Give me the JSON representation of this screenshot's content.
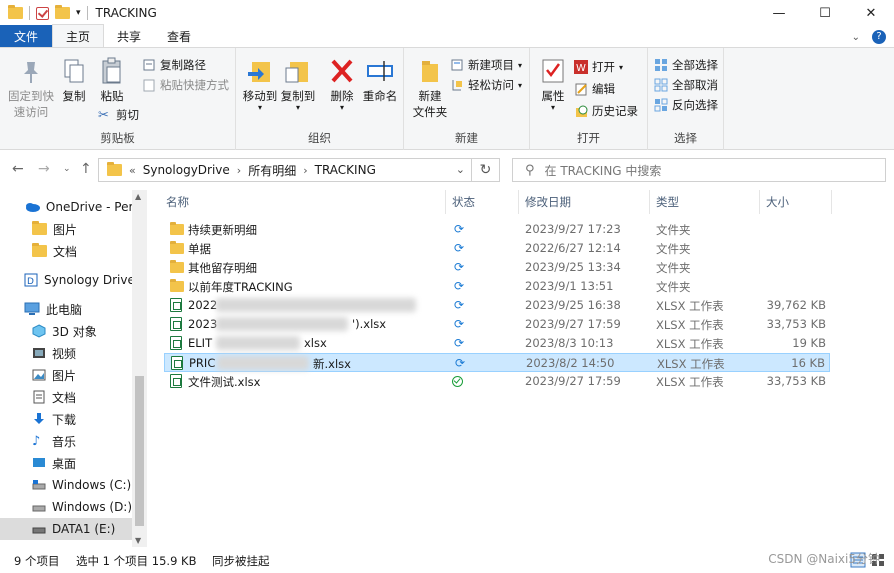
{
  "window": {
    "title": "TRACKING",
    "controls": {
      "minimize": "—",
      "maximize": "☐",
      "close": "✕"
    }
  },
  "ribbon_tabs": [
    "文件",
    "主页",
    "共享",
    "查看"
  ],
  "ribbon": {
    "clipboard": {
      "label": "剪贴板",
      "pin": "固定到快\n速访问",
      "copy": "复制",
      "paste": "粘贴",
      "copy_path": "复制路径",
      "paste_shortcut": "粘贴快捷方式",
      "cut": "剪切"
    },
    "organize": {
      "label": "组织",
      "move_to": "移动到",
      "copy_to": "复制到",
      "delete": "删除",
      "rename": "重命名"
    },
    "new": {
      "label": "新建",
      "new_folder": "新建\n文件夹",
      "new_item": "新建项目",
      "easy_access": "轻松访问"
    },
    "open": {
      "label": "打开",
      "properties": "属性",
      "open": "打开",
      "edit": "编辑",
      "history": "历史记录"
    },
    "select": {
      "label": "选择",
      "select_all": "全部选择",
      "select_none": "全部取消",
      "invert": "反向选择"
    }
  },
  "address": {
    "prefix": "«",
    "crumbs": [
      "SynologyDrive",
      "所有明细",
      "TRACKING"
    ],
    "search_placeholder": "在 TRACKING 中搜索"
  },
  "nav_items": [
    {
      "label": "OneDrive - Perso",
      "icon": "cloud-icon"
    },
    {
      "label": "图片",
      "icon": "folder-icon"
    },
    {
      "label": "文档",
      "icon": "folder-icon"
    },
    {
      "label": "Synology Drive -",
      "icon": "synology-icon"
    },
    {
      "label": "此电脑",
      "icon": "computer-icon"
    },
    {
      "label": "3D 对象",
      "icon": "cube-icon"
    },
    {
      "label": "视频",
      "icon": "video-icon"
    },
    {
      "label": "图片",
      "icon": "picture-icon"
    },
    {
      "label": "文档",
      "icon": "document-icon"
    },
    {
      "label": "下载",
      "icon": "download-icon"
    },
    {
      "label": "音乐",
      "icon": "music-icon"
    },
    {
      "label": "桌面",
      "icon": "desktop-icon"
    },
    {
      "label": "Windows (C:)",
      "icon": "drive-icon"
    },
    {
      "label": "Windows (D:)",
      "icon": "drive-icon"
    },
    {
      "label": "DATA1 (E:)",
      "icon": "drive-icon"
    }
  ],
  "columns": {
    "name": "名称",
    "status": "状态",
    "modified": "修改日期",
    "type": "类型",
    "size": "大小"
  },
  "files": [
    {
      "name": "持续更新明细",
      "kind": "folder",
      "status": "sync",
      "modified": "2023/9/27 17:23",
      "type": "文件夹",
      "size": ""
    },
    {
      "name": "单据",
      "kind": "folder",
      "status": "sync",
      "modified": "2022/6/27 12:14",
      "type": "文件夹",
      "size": ""
    },
    {
      "name": "其他留存明细",
      "kind": "folder",
      "status": "sync",
      "modified": "2023/9/25 13:34",
      "type": "文件夹",
      "size": ""
    },
    {
      "name": "以前年度TRACKING",
      "kind": "folder",
      "status": "sync",
      "modified": "2023/9/1 13:51",
      "type": "文件夹",
      "size": ""
    },
    {
      "name": "2022",
      "kind": "xlsx",
      "status": "sync",
      "modified": "2023/9/25 16:38",
      "type": "XLSX 工作表",
      "size": "39,762 KB"
    },
    {
      "name": "2023",
      "name_tail": "').xlsx",
      "kind": "xlsx",
      "status": "sync",
      "modified": "2023/9/27 17:59",
      "type": "XLSX 工作表",
      "size": "33,753 KB"
    },
    {
      "name": "ELIT",
      "name_tail": "xlsx",
      "kind": "xlsx",
      "status": "sync",
      "modified": "2023/8/3 10:13",
      "type": "XLSX 工作表",
      "size": "19 KB"
    },
    {
      "name": "PRIC",
      "name_tail": "新.xlsx",
      "kind": "xlsx",
      "status": "sync",
      "modified": "2023/8/2 14:50",
      "type": "XLSX 工作表",
      "size": "16 KB",
      "selected": true
    },
    {
      "name": "文件测试.xlsx",
      "kind": "xlsx",
      "status": "ok",
      "modified": "2023/9/27 17:59",
      "type": "XLSX 工作表",
      "size": "33,753 KB"
    }
  ],
  "statusbar": {
    "count": "9 个项目",
    "selected": "选中 1 个项目  15.9 KB",
    "sync": "同步被挂起"
  },
  "watermark": "CSDN @Naixi5分钟"
}
